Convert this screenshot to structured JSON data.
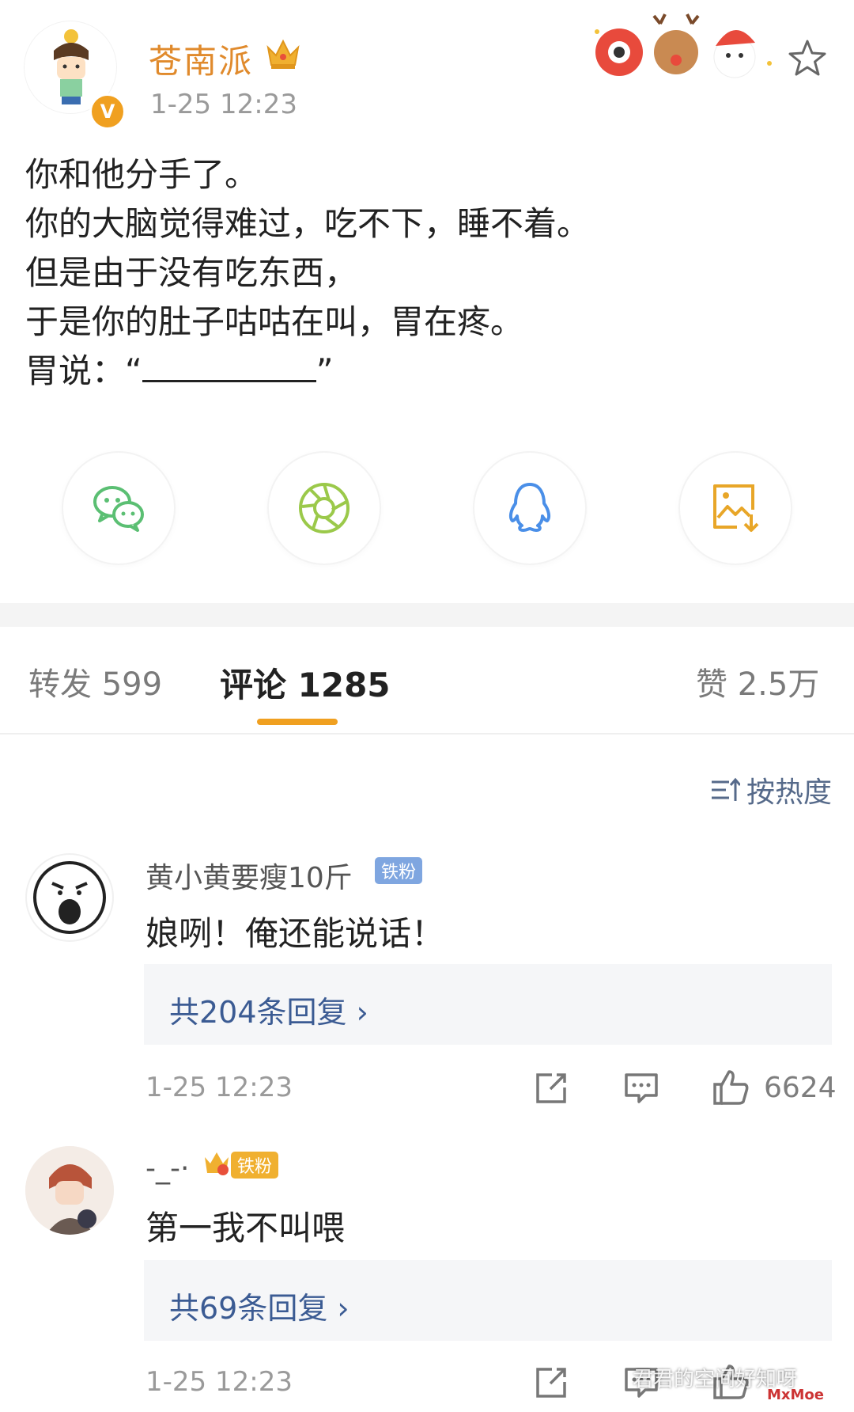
{
  "post": {
    "author": "苍南派",
    "time": "1-25 12:23",
    "verified_mark": "V",
    "lines": [
      "你和他分手了。",
      "你的大脑觉得难过，吃不下，睡不着。",
      "但是由于没有吃东西，",
      "于是你的肚子咕咕在叫，胃在疼。"
    ],
    "last_line_prefix": "胃说：“",
    "last_line_suffix": "”"
  },
  "share": {
    "icons": [
      "wechat-icon",
      "moments-icon",
      "qq-icon",
      "save-image-icon"
    ]
  },
  "tabs": {
    "repost": "转发 599",
    "comments": "评论 1285",
    "likes": "赞 2.5万"
  },
  "sort": {
    "label": "按热度"
  },
  "comments": [
    {
      "name": "黄小黄要瘦10斤",
      "badge": "铁粉",
      "text": "娘咧！俺还能说话！",
      "replies": "共204条回复 ›",
      "time": "1-25 12:23",
      "likes": "6624"
    },
    {
      "name": "-_-·",
      "badge": "铁粉",
      "text": "第一我不叫喂",
      "replies": "共69条回复 ›",
      "time": "1-25 12:23"
    }
  ],
  "watermark": {
    "text": "君君的空间好知呀",
    "logo": "MxMoe"
  },
  "colors": {
    "accent": "#f0a020",
    "name_orange": "#e08a2c",
    "link_blue": "#3b5b93",
    "fan_badge": "#7fa6e0"
  }
}
